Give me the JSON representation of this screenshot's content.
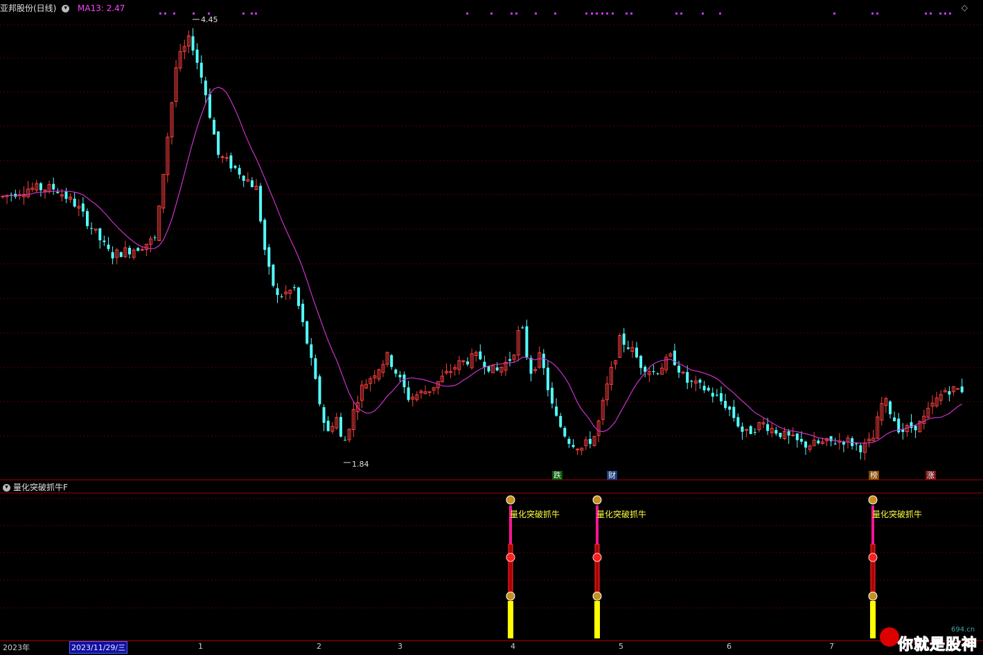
{
  "main_panel": {
    "title": "亚邦股份(日线)",
    "ma_label": "MA13: 2.47",
    "high_label": "4.45",
    "low_label": "1.84",
    "menu_icon": "chevron-down-circle-icon",
    "diamond_icon": "diamond-icon"
  },
  "indicator_panel": {
    "title": "量化突破抓牛F",
    "signal_label": "量化突破抓牛"
  },
  "badges": {
    "fall": "跌",
    "money": "财",
    "list": "榜",
    "rise": "涨"
  },
  "axis": {
    "year": "2023年",
    "selected_date": "2023/11/29/三",
    "months": [
      "1",
      "2",
      "3",
      "4",
      "5",
      "6",
      "7"
    ]
  },
  "watermark": {
    "domain": "694.cn",
    "text": "你就是股神"
  },
  "colors": {
    "up": "#ff4040",
    "down": "#54ffff",
    "ma": "#cc33cc",
    "grid": "#5a0000",
    "signal_pink": "#ff1493",
    "signal_yellow": "#ffff00"
  },
  "chart_data": {
    "type": "candlestick",
    "price_range": [
      1.84,
      4.45
    ],
    "ma_name": "MA13",
    "ma_last": 2.47
  }
}
